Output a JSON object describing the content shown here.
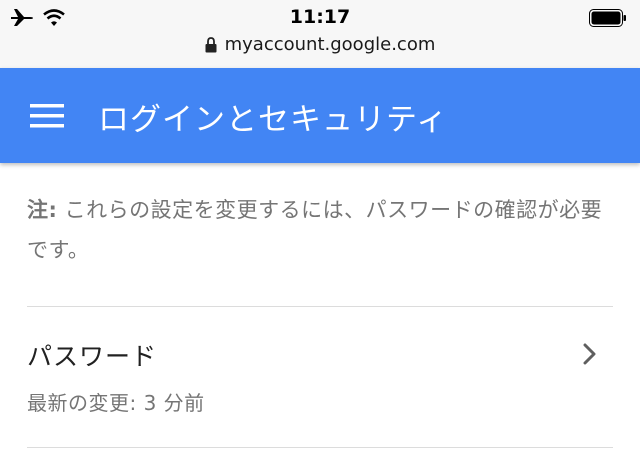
{
  "status_bar": {
    "time": "11:17",
    "icons": [
      "airplane-icon",
      "wifi-icon",
      "battery-icon"
    ]
  },
  "address_bar": {
    "url": "myaccount.google.com",
    "icon": "lock-icon"
  },
  "app_bar": {
    "title": "ログインとセキュリティ",
    "menu_icon": "hamburger-menu-icon",
    "color": "#4285f4"
  },
  "note": {
    "label": "注:",
    "text": " これらの設定を変更するには、パスワードの確認が必要です。"
  },
  "password_item": {
    "title": "パスワード",
    "subtitle": "最新の変更: 3 分前",
    "icon": "chevron-right-icon"
  }
}
